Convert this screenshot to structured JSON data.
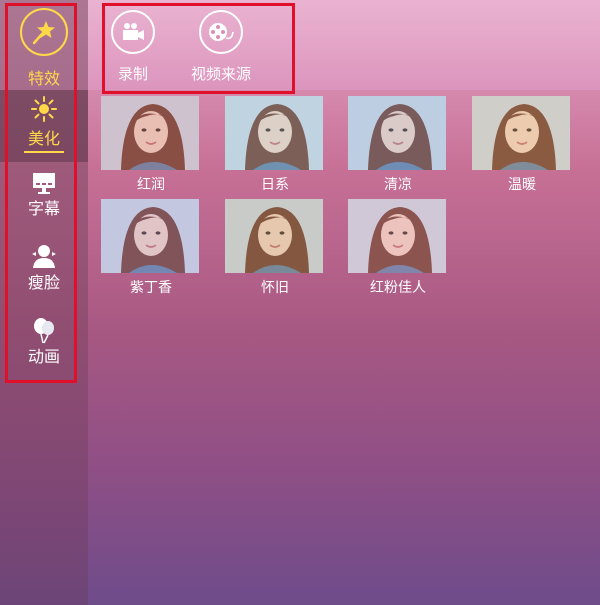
{
  "sidebar": {
    "items": [
      {
        "label": "特效",
        "icon": "magic-wand-icon",
        "active": false
      },
      {
        "label": "美化",
        "icon": "sparkle-icon",
        "active": true
      },
      {
        "label": "字幕",
        "icon": "subtitle-screen-icon"
      },
      {
        "label": "瘦脸",
        "icon": "person-icon"
      },
      {
        "label": "动画",
        "icon": "balloon-icon"
      }
    ]
  },
  "toolbar": {
    "items": [
      {
        "label": "录制",
        "icon": "video-camera-icon"
      },
      {
        "label": "视频来源",
        "icon": "film-reel-icon"
      }
    ]
  },
  "filters": [
    {
      "label": "红润",
      "tint": "#d98a8a"
    },
    {
      "label": "日系",
      "tint": "#a9c6cc"
    },
    {
      "label": "清凉",
      "tint": "#9fb2d8"
    },
    {
      "label": "温暖",
      "tint": "#e0b27a"
    },
    {
      "label": "紫丁香",
      "tint": "#b89acb"
    },
    {
      "label": "怀旧",
      "tint": "#c7a878"
    },
    {
      "label": "红粉佳人",
      "tint": "#e39aad"
    }
  ],
  "colors": {
    "accent": "#ffd84a",
    "highlight": "#e0102a"
  }
}
